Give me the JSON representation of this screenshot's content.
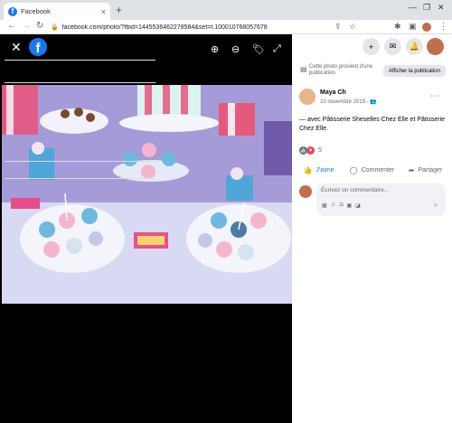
{
  "browser": {
    "tab_title": "Facebook",
    "tab_close": "×",
    "new_tab": "+",
    "url": "facebook.com/photo/?fbid=1445536462278584&set=t.100010768057678",
    "win_min": "—",
    "win_max": "❐",
    "win_close": "✕"
  },
  "viewer": {
    "close_glyph": "✕",
    "logo_letter": "f",
    "zoom_in": "⊕",
    "zoom_out": "⊖",
    "tag": "🏷",
    "fullscreen": "⤢"
  },
  "panel": {
    "info_text": "Cette photo provient d'une publication.",
    "show_publication": "Afficher la publication",
    "author": "Maya Ch",
    "date": "10 novembre 2019 · 👥",
    "caption": "— avec Pâtisserie Sheselles Chez Elle et Pâtisserie Chez Elle.",
    "reaction_count": "5",
    "actions": {
      "like": "J'aime",
      "comment": "Commenter",
      "share": "Partager"
    },
    "comment_placeholder": "Écrivez un commentaire..."
  },
  "colors": {
    "facebook_blue": "#1877f2",
    "love_red": "#f33e58"
  }
}
